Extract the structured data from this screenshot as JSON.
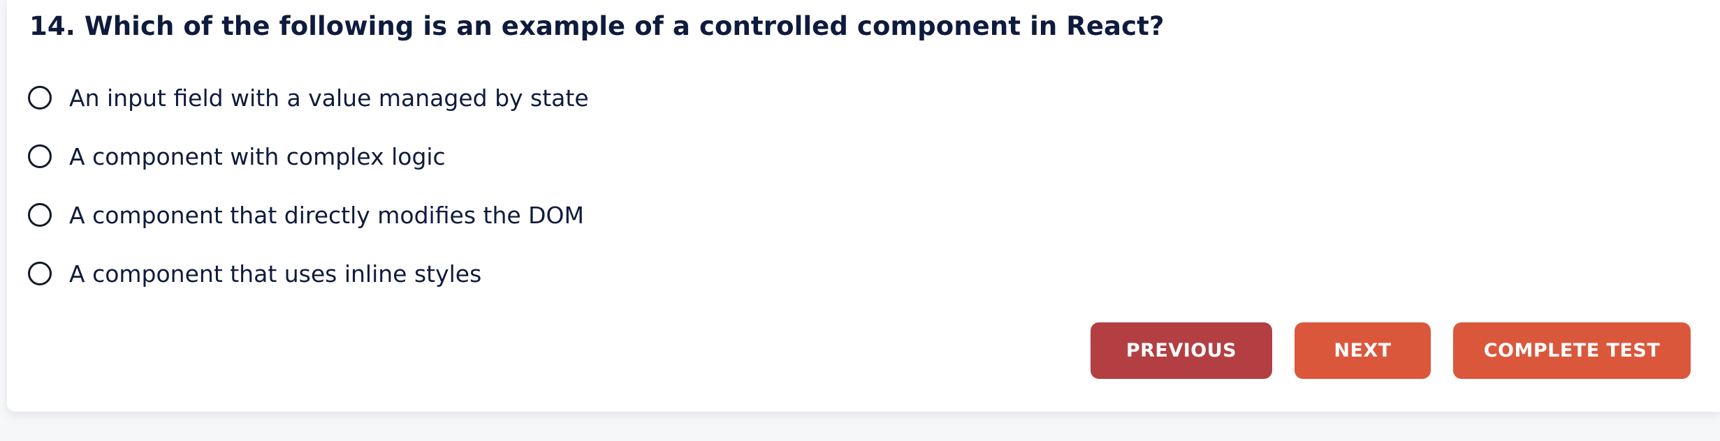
{
  "question": {
    "text": "14. Which of the following is an example of a controlled component in React?"
  },
  "options": [
    {
      "label": "An input field with a value managed by state",
      "selected": false
    },
    {
      "label": "A component with complex logic",
      "selected": false
    },
    {
      "label": "A component that directly modifies the DOM",
      "selected": false
    },
    {
      "label": "A component that uses inline styles",
      "selected": false
    }
  ],
  "actions": {
    "previous_label": "PREVIOUS",
    "next_label": "NEXT",
    "complete_label": "COMPLETE TEST"
  },
  "colors": {
    "text": "#0f1b3d",
    "previous_button": "#b33f42",
    "primary_button": "#db573c",
    "background": "#f6f7f9",
    "card": "#ffffff"
  }
}
